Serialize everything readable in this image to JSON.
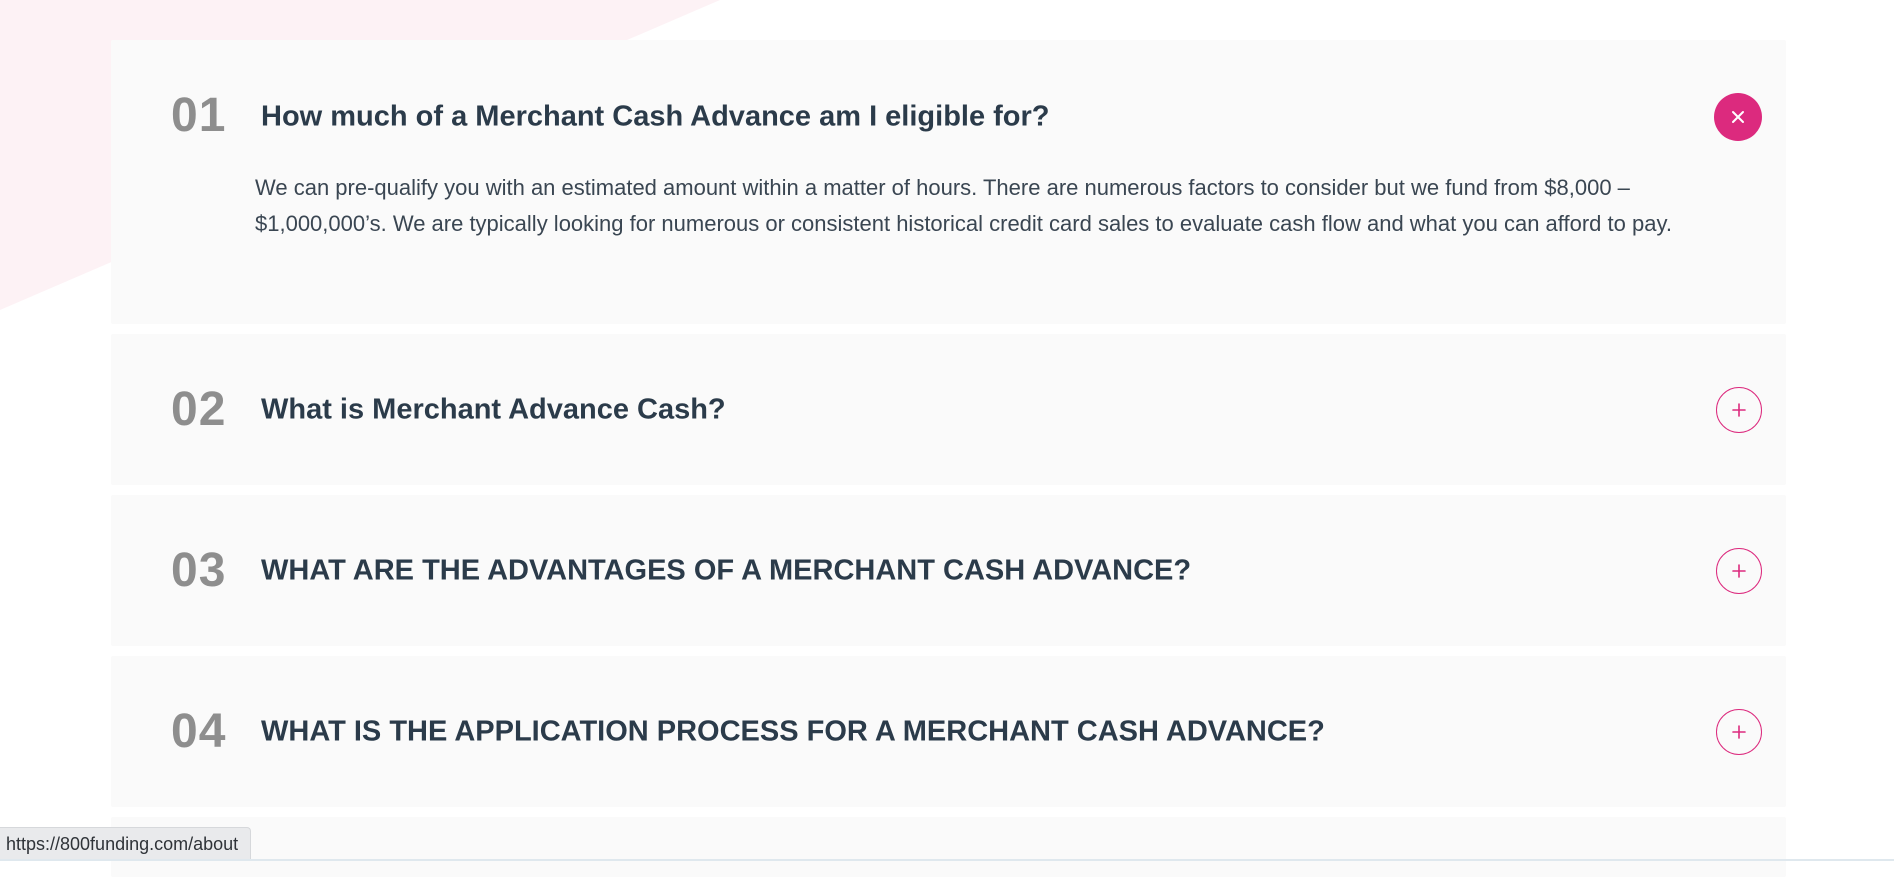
{
  "faq": {
    "items": [
      {
        "number": "01",
        "title": "How much of a Merchant Cash Advance am I eligible for?",
        "answer": "We can pre-qualify you with an estimated amount within a matter of hours. There are numerous factors to consider but we fund from $8,000 – $1,000,000’s. We are typically looking for numerous or consistent historical credit card sales to evaluate cash flow and what you can afford to pay.",
        "state": "open",
        "toggle_icon": "close-icon"
      },
      {
        "number": "02",
        "title": "What is Merchant Advance Cash?",
        "state": "closed",
        "toggle_icon": "plus-icon"
      },
      {
        "number": "03",
        "title": "WHAT ARE THE ADVANTAGES OF A MERCHANT CASH ADVANCE?",
        "state": "closed",
        "toggle_icon": "plus-icon"
      },
      {
        "number": "04",
        "title": "WHAT IS THE APPLICATION PROCESS FOR A MERCHANT CASH ADVANCE?",
        "state": "closed",
        "toggle_icon": "plus-icon"
      }
    ]
  },
  "status_bar": {
    "link_url": "https://800funding.com/about"
  },
  "colors": {
    "accent": "#dc2a7e",
    "heading": "#2b3b4a",
    "number": "#8e8e8e",
    "body_text": "#3a4652",
    "card_background": "#fafafa",
    "background_shape": "#fdf2f5"
  }
}
